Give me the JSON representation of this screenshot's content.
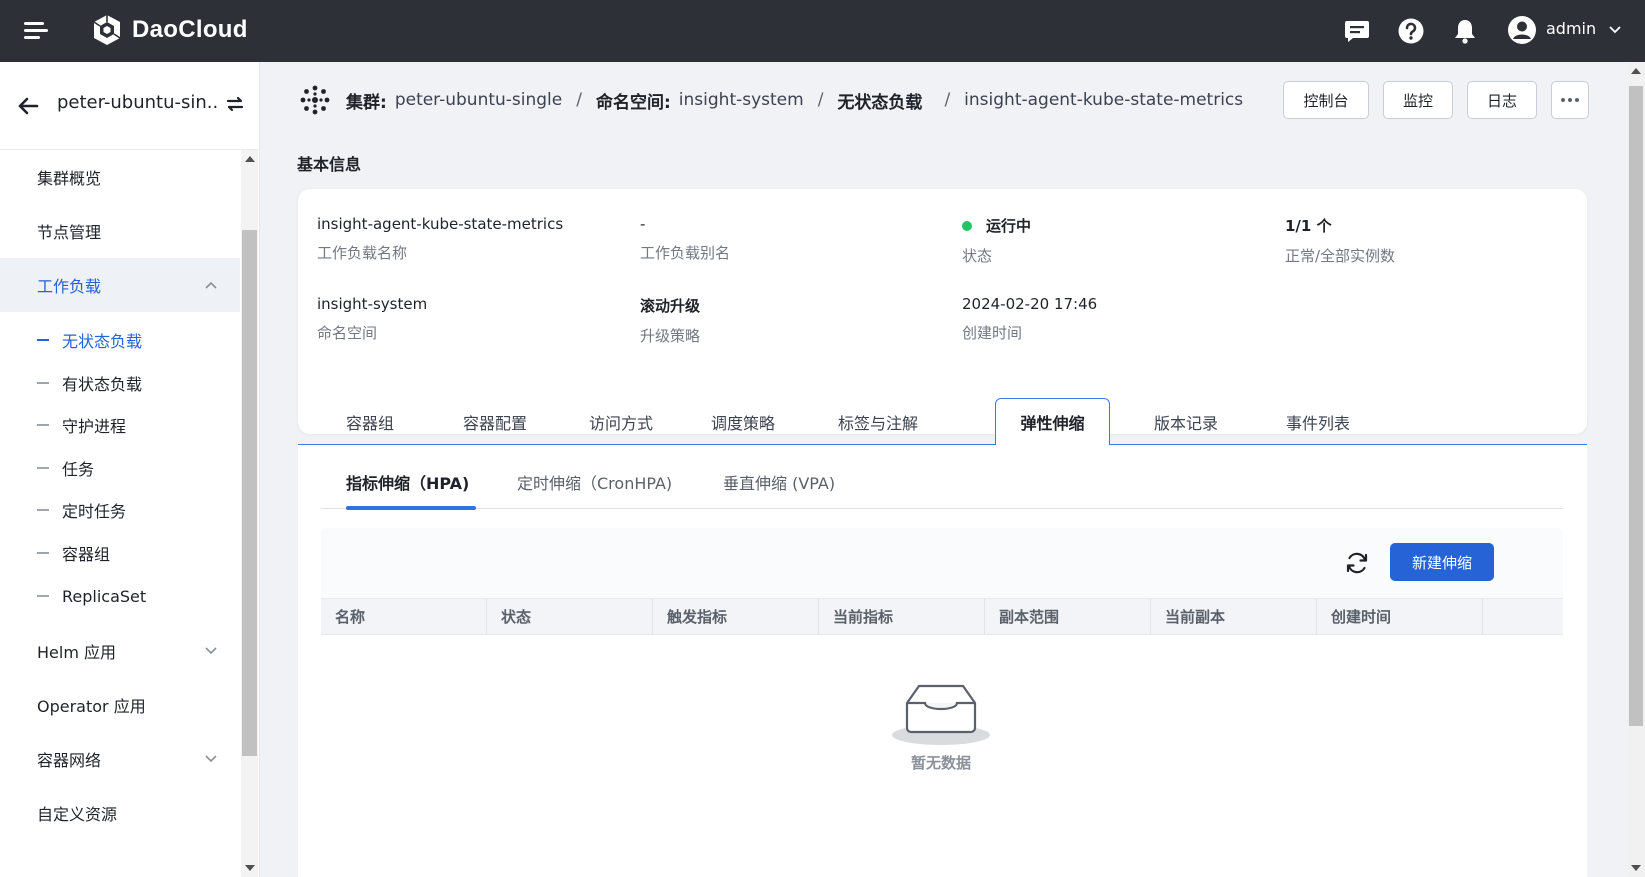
{
  "app": {
    "brand": "DaoCloud",
    "user": "admin"
  },
  "sidebar": {
    "cluster_name": "peter-ubuntu-sin...",
    "menu": [
      {
        "label": "集群概览"
      },
      {
        "label": "节点管理"
      },
      {
        "label": "工作负载"
      },
      {
        "label": "Helm 应用"
      },
      {
        "label": "Operator 应用"
      },
      {
        "label": "容器网络"
      },
      {
        "label": "自定义资源"
      }
    ],
    "workload_children": [
      {
        "label": "无状态负载"
      },
      {
        "label": "有状态负载"
      },
      {
        "label": "守护进程"
      },
      {
        "label": "任务"
      },
      {
        "label": "定时任务"
      },
      {
        "label": "容器组"
      },
      {
        "label": "ReplicaSet"
      }
    ]
  },
  "breadcrumb": {
    "cluster_key": "集群:",
    "cluster_val": "peter-ubuntu-single",
    "ns_key": "命名空间:",
    "ns_val": "insight-system",
    "type_key": "无状态负载",
    "name": "insight-agent-kube-state-metrics",
    "sep": "/"
  },
  "actions": {
    "console": "控制台",
    "monitor": "监控",
    "logs": "日志"
  },
  "basic_info": {
    "title": "基本信息",
    "fields": [
      {
        "value": "insight-agent-kube-state-metrics",
        "label": "工作负载名称"
      },
      {
        "value": "-",
        "label": "工作负载别名"
      },
      {
        "value": "运行中",
        "label": "状态"
      },
      {
        "value": "1/1 个",
        "label": "正常/全部实例数"
      },
      {
        "value": "insight-system",
        "label": "命名空间"
      },
      {
        "value": "滚动升级",
        "label": "升级策略"
      },
      {
        "value": "2024-02-20 17:46",
        "label": "创建时间"
      }
    ]
  },
  "tabs": [
    "容器组",
    "容器配置",
    "访问方式",
    "调度策略",
    "标签与注解",
    "弹性伸缩",
    "版本记录",
    "事件列表"
  ],
  "subtabs": [
    "指标伸缩（HPA)",
    "定时伸缩（CronHPA)",
    "垂直伸缩 (VPA)"
  ],
  "table": {
    "new_button": "新建伸缩",
    "columns": [
      "名称",
      "状态",
      "触发指标",
      "当前指标",
      "副本范围",
      "当前副本",
      "创建时间"
    ],
    "empty_text": "暂无数据"
  },
  "colors": {
    "accent": "#2563d6",
    "topbar": "#2d3036",
    "running": "#27c263"
  }
}
